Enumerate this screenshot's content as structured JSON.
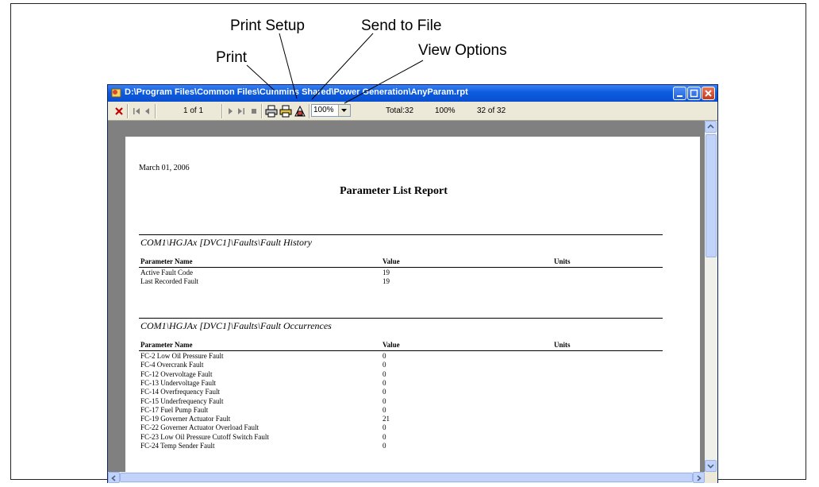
{
  "callouts": {
    "print": "Print",
    "print_setup": "Print Setup",
    "send_to_file": "Send to File",
    "view_options": "View Options"
  },
  "window": {
    "title": "D:\\Program Files\\Common Files\\Cummins Shared\\Power Generation\\AnyParam.rpt"
  },
  "toolbar": {
    "page_indicator": "1 of 1",
    "zoom_value": "100%",
    "total": "Total:32",
    "percent": "100%",
    "count": "32 of 32"
  },
  "report": {
    "date": "March 01, 2006",
    "title": "Parameter List Report",
    "columns": [
      "Parameter Name",
      "Value",
      "Units"
    ],
    "sections": [
      {
        "title": "COM1\\HGJAx [DVC1]\\Faults\\Fault History",
        "rows": [
          [
            "Active Fault Code",
            "19",
            ""
          ],
          [
            "Last Recorded Fault",
            "19",
            ""
          ]
        ]
      },
      {
        "title": "COM1\\HGJAx [DVC1]\\Faults\\Fault Occurrences",
        "rows": [
          [
            "FC-2 Low Oil Pressure Fault",
            "0",
            ""
          ],
          [
            "FC-4 Overcrank Fault",
            "0",
            ""
          ],
          [
            "FC-12 Overvoltage Fault",
            "0",
            ""
          ],
          [
            "FC-13 Undervoltage Fault",
            "0",
            ""
          ],
          [
            "FC-14 Overfrequency Fault",
            "0",
            ""
          ],
          [
            "FC-15 Underfrequency Fault",
            "0",
            ""
          ],
          [
            "FC-17 Fuel Pump Fault",
            "0",
            ""
          ],
          [
            "FC-19 Governer Actuator Fault",
            "21",
            ""
          ],
          [
            "FC-22 Governer Actuator Overload Fault",
            "0",
            ""
          ],
          [
            "FC-23 Low Oil Pressure Cutoff Switch Fault",
            "0",
            ""
          ],
          [
            "FC-24 Temp Sender Fault",
            "0",
            ""
          ]
        ]
      }
    ]
  },
  "colors": {
    "titlebar": "#0c5be0",
    "toolbar": "#ece9d8",
    "viewport": "#808080",
    "close_button": "#c4391c"
  }
}
